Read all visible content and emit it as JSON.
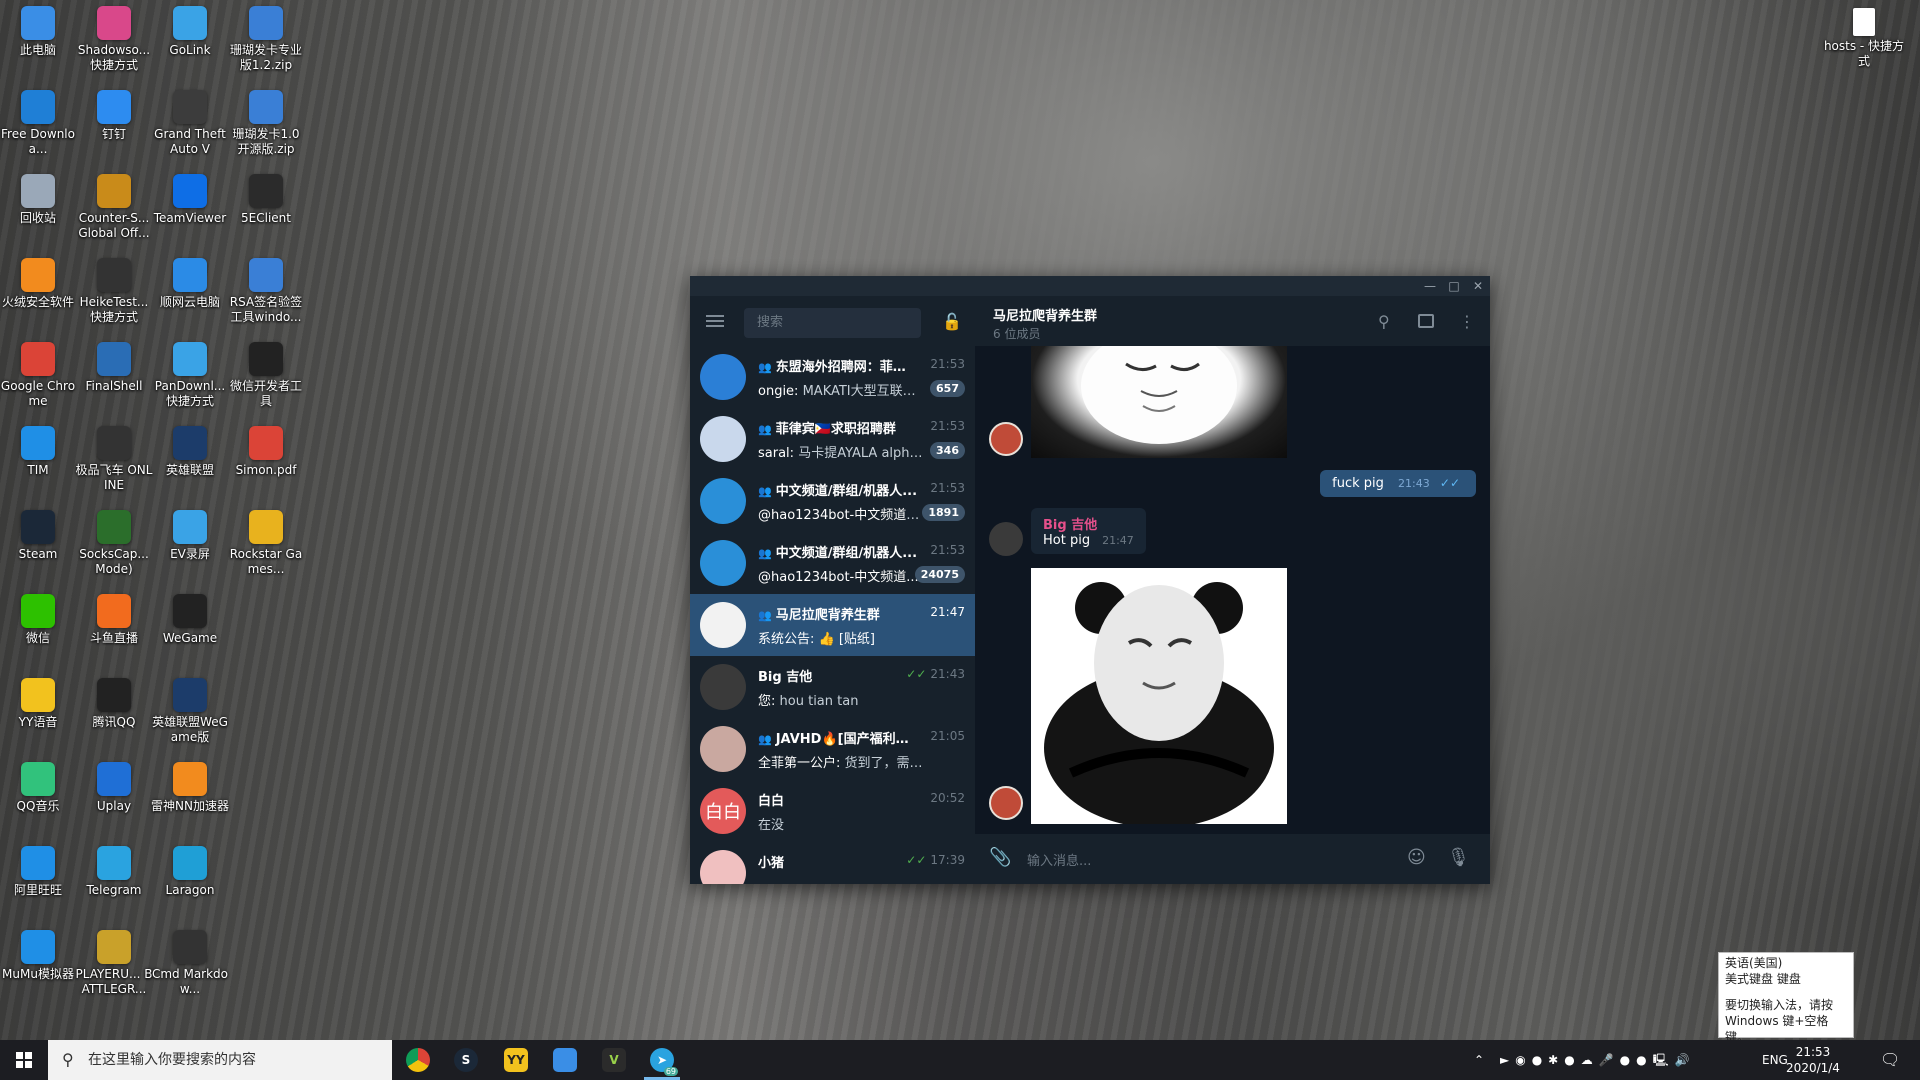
{
  "desktop": {
    "icons": [
      {
        "label": "此电脑",
        "icon": "computer-icon",
        "color": "#3a8ee6"
      },
      {
        "label": "Shadowso...快捷方式",
        "icon": "shadowsocks-icon",
        "color": "#d9488a"
      },
      {
        "label": "GoLink",
        "icon": "golink-icon",
        "color": "#3aa3e6"
      },
      {
        "label": "珊瑚发卡专业版1.2.zip",
        "icon": "zip-folder-icon",
        "color": "#3a7fd6"
      },
      {
        "label": "Free Downloa...",
        "icon": "free-download-icon",
        "color": "#1f7fd6"
      },
      {
        "label": "钉钉",
        "icon": "dingtalk-icon",
        "color": "#2d8cf0"
      },
      {
        "label": "Grand Theft Auto V",
        "icon": "gta-icon",
        "color": "#3c3c3c"
      },
      {
        "label": "珊瑚发卡1.0开源版.zip",
        "icon": "zip-folder-icon",
        "color": "#3a7fd6"
      },
      {
        "label": "回收站",
        "icon": "recycle-bin-icon",
        "color": "#9aa8b8"
      },
      {
        "label": "Counter-S... Global Off...",
        "icon": "csgo-icon",
        "color": "#c98b1a"
      },
      {
        "label": "TeamViewer",
        "icon": "teamviewer-icon",
        "color": "#0e6ee6"
      },
      {
        "label": "5EClient",
        "icon": "5eclient-icon",
        "color": "#2b2b2b"
      },
      {
        "label": "火绒安全软件",
        "icon": "huorong-icon",
        "color": "#f28b1e"
      },
      {
        "label": "HeikeTest...快捷方式",
        "icon": "heiketest-icon",
        "color": "#333"
      },
      {
        "label": "顺网云电脑",
        "icon": "shunwang-icon",
        "color": "#2b8be6"
      },
      {
        "label": "RSA签名验签工具windo...",
        "icon": "rsa-folder-icon",
        "color": "#3a7fd6"
      },
      {
        "label": "Google Chrome",
        "icon": "chrome-icon",
        "color": "#db4437"
      },
      {
        "label": "FinalShell",
        "icon": "finalshell-icon",
        "color": "#2a6db5"
      },
      {
        "label": "PanDownl...快捷方式",
        "icon": "pandownload-icon",
        "color": "#3aa3e6"
      },
      {
        "label": "微信开发者工具",
        "icon": "wechat-devtools-icon",
        "color": "#222"
      },
      {
        "label": "TIM",
        "icon": "tim-icon",
        "color": "#1f8fe6"
      },
      {
        "label": "极品飞车 ONLINE",
        "icon": "nfs-icon",
        "color": "#333"
      },
      {
        "label": "英雄联盟",
        "icon": "lol-icon",
        "color": "#1c3c6a"
      },
      {
        "label": "Simon.pdf",
        "icon": "pdf-chrome-icon",
        "color": "#db4437"
      },
      {
        "label": "Steam",
        "icon": "steam-icon",
        "color": "#1b2838"
      },
      {
        "label": "SocksCap...Mode)",
        "icon": "sockscap-icon",
        "color": "#2b6e2b"
      },
      {
        "label": "EV录屏",
        "icon": "ev-recorder-icon",
        "color": "#3aa3e6"
      },
      {
        "label": "Rockstar Games...",
        "icon": "rockstar-icon",
        "color": "#e8b21e"
      },
      {
        "label": "微信",
        "icon": "wechat-icon",
        "color": "#2dc100"
      },
      {
        "label": "斗鱼直播",
        "icon": "douyu-icon",
        "color": "#f26b1e"
      },
      {
        "label": "WeGame",
        "icon": "wegame-icon",
        "color": "#222"
      },
      {
        "label": "",
        "icon": "",
        "color": ""
      },
      {
        "label": "YY语音",
        "icon": "yy-icon",
        "color": "#f2c21e"
      },
      {
        "label": "腾讯QQ",
        "icon": "qq-icon",
        "color": "#222"
      },
      {
        "label": "英雄联盟WeGame版",
        "icon": "lol-wegame-icon",
        "color": "#1c3c6a"
      },
      {
        "label": "",
        "icon": "",
        "color": ""
      },
      {
        "label": "QQ音乐",
        "icon": "qqmusic-icon",
        "color": "#31c27c"
      },
      {
        "label": "Uplay",
        "icon": "uplay-icon",
        "color": "#1f6fd6"
      },
      {
        "label": "雷神NN加速器",
        "icon": "nn-accelerator-icon",
        "color": "#f28b1e"
      },
      {
        "label": "",
        "icon": "",
        "color": ""
      },
      {
        "label": "阿里旺旺",
        "icon": "aliwangwang-icon",
        "color": "#1f8fe6"
      },
      {
        "label": "Telegram",
        "icon": "telegram-icon",
        "color": "#2aa3e0"
      },
      {
        "label": "Laragon",
        "icon": "laragon-icon",
        "color": "#1f9fd6"
      },
      {
        "label": "",
        "icon": "",
        "color": ""
      },
      {
        "label": "MuMu模拟器",
        "icon": "mumu-icon",
        "color": "#1f8fe6"
      },
      {
        "label": "PLAYERU... BATTLEGR...",
        "icon": "pubg-icon",
        "color": "#c9a12a"
      },
      {
        "label": "Cmd Markdow...",
        "icon": "cmd-markdown-icon",
        "color": "#333"
      }
    ],
    "right_icon": {
      "label": "hosts - 快捷方式",
      "icon": "hosts-file-icon"
    }
  },
  "telegram": {
    "search_placeholder": "搜索",
    "chats": [
      {
        "name": "东盟海外招聘网：菲律...",
        "time": "21:53",
        "sender": "ongie:",
        "preview": "MAKATI大型互联网...",
        "badge": "657",
        "group": true,
        "avatar_color": "#2b7fd6",
        "avatar_icon": "mountain-logo-icon"
      },
      {
        "name": "菲律宾🇵🇭求职招聘群",
        "time": "21:53",
        "sender": "saral:",
        "preview": "马卡提AYALA alphala...",
        "badge": "346",
        "group": true,
        "avatar_color": "#c9d8ec",
        "avatar_icon": "seal-logo-icon"
      },
      {
        "name": "中文频道/群组/机器人...",
        "time": "21:53",
        "sender": "@hao1234bot-中文频道群...",
        "preview": "",
        "badge": "1891",
        "group": true,
        "avatar_color": "#2a8fd8",
        "avatar_icon": "megaphone-icon"
      },
      {
        "name": "中文频道/群组/机器人...",
        "time": "21:53",
        "sender": "@hao1234bot-中文频道...",
        "preview": "",
        "badge": "24075",
        "group": true,
        "avatar_color": "#2a8fd8",
        "avatar_icon": "megaphone-icon"
      },
      {
        "name": "马尼拉爬背养生群",
        "time": "21:47",
        "sender": "系统公告:",
        "preview": "👍 [贴纸]",
        "badge": "",
        "group": true,
        "avatar_color": "#f2f2f2",
        "avatar_icon": "pig-logo-icon"
      },
      {
        "name": "Big 吉他",
        "time": "21:43",
        "sender": "您:",
        "preview": "hou tian tan",
        "badge": "",
        "group": false,
        "avatar_color": "#3a3a3a",
        "avatar_icon": "person-photo-icon",
        "read": true
      },
      {
        "name": "JAVHD🔥[国产福利社...",
        "time": "21:05",
        "sender": "全菲第一公户:",
        "preview": "货到了，需要联系😊",
        "badge": "",
        "group": true,
        "avatar_color": "#c9a8a0",
        "avatar_icon": "girl-photo-icon"
      },
      {
        "name": "白白",
        "time": "20:52",
        "sender": "",
        "preview": "在没",
        "badge": "",
        "group": false,
        "avatar_color": "#e35a5a",
        "avatar_text": "白白"
      },
      {
        "name": "小猪",
        "time": "17:39",
        "sender": "",
        "preview": "",
        "badge": "",
        "group": false,
        "avatar_color": "#f0c0c0",
        "avatar_icon": "pig-photo-icon",
        "read": true
      }
    ],
    "conversation": {
      "title": "马尼拉爬背养生群",
      "subtitle": "6 位成员",
      "outgoing": {
        "text": "fuck pig",
        "time": "21:43"
      },
      "incoming": {
        "author": "Big 吉他",
        "text": "Hot pig",
        "time": "21:47"
      },
      "composer_placeholder": "输入消息..."
    }
  },
  "ime_tip": {
    "line1": "英语(美国)",
    "line2": "美式键盘 键盘",
    "line3": "要切换输入法，请按",
    "line4": "Windows 键+空格键。"
  },
  "taskbar": {
    "search_placeholder": "在这里输入你要搜索的内容",
    "lang": "ENG",
    "time": "21:53",
    "date": "2020/1/4",
    "telegram_badge": "69"
  }
}
